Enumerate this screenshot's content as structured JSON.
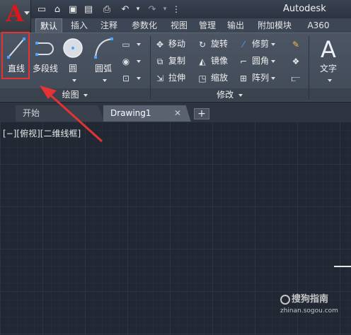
{
  "window": {
    "title": "Autodesk"
  },
  "quick_access": {
    "items": [
      "new-icon",
      "open-icon",
      "save-icon",
      "save-as-icon",
      "print-icon",
      "undo-icon",
      "redo-icon"
    ]
  },
  "ribbon_tabs": [
    {
      "label": "默认",
      "active": true
    },
    {
      "label": "插入"
    },
    {
      "label": "注释"
    },
    {
      "label": "参数化"
    },
    {
      "label": "视图"
    },
    {
      "label": "管理"
    },
    {
      "label": "输出"
    },
    {
      "label": "附加模块"
    },
    {
      "label": "A360"
    }
  ],
  "draw_panel": {
    "title": "绘图",
    "tools": [
      {
        "label": "直线",
        "icon": "line-icon"
      },
      {
        "label": "多段线",
        "icon": "polyline-icon"
      },
      {
        "label": "圆",
        "icon": "circle-icon"
      },
      {
        "label": "圆弧",
        "icon": "arc-icon"
      }
    ]
  },
  "modify_panel": {
    "title": "修改",
    "tools": [
      {
        "label": "移动",
        "icon": "move-icon"
      },
      {
        "label": "旋转",
        "icon": "rotate-icon"
      },
      {
        "label": "修剪",
        "icon": "trim-icon"
      },
      {
        "label": "复制",
        "icon": "copy-icon"
      },
      {
        "label": "镜像",
        "icon": "mirror-icon"
      },
      {
        "label": "圆角",
        "icon": "fillet-icon"
      },
      {
        "label": "拉伸",
        "icon": "stretch-icon"
      },
      {
        "label": "缩放",
        "icon": "scale-icon"
      },
      {
        "label": "阵列",
        "icon": "array-icon"
      }
    ]
  },
  "annotation_panel": {
    "tools": [
      {
        "label": "文字",
        "icon": "text-icon"
      }
    ]
  },
  "doc_tabs": [
    {
      "label": "开始",
      "active": false
    },
    {
      "label": "Drawing1",
      "active": true
    }
  ],
  "canvas": {
    "viewport_label": "[−][俯视][二维线框]"
  },
  "watermark": {
    "main": "搜狗指南",
    "sub": "zhinan.sogou.com"
  },
  "colors": {
    "highlight": "#e53333",
    "canvas_bg": "#212833",
    "app_logo": "#d8181b"
  }
}
